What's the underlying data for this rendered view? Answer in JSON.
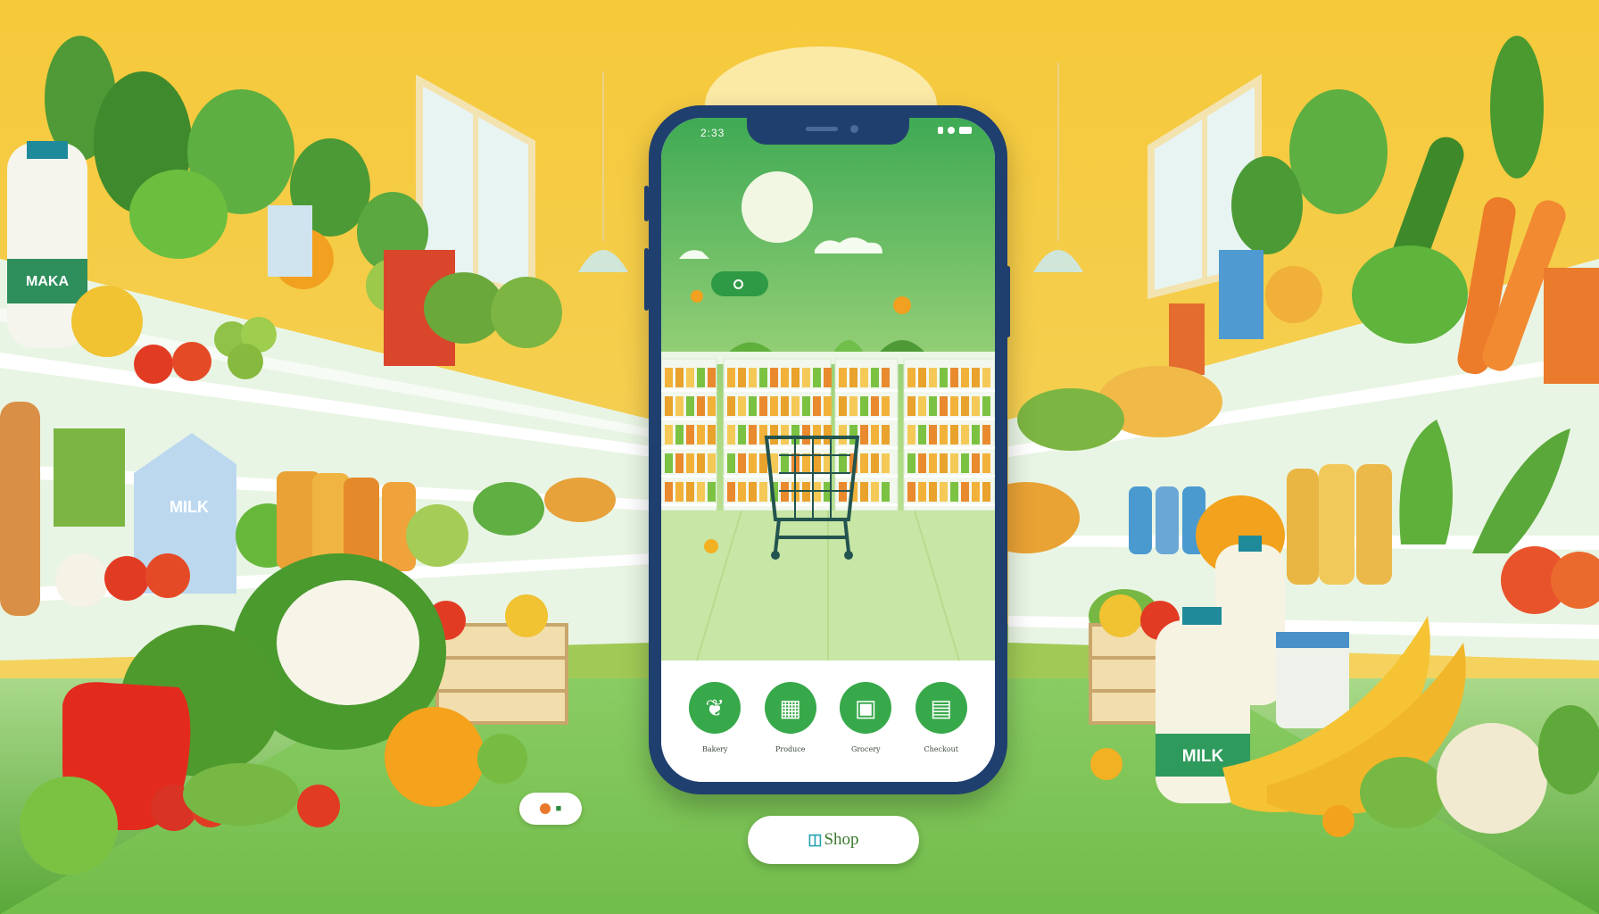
{
  "phone": {
    "status_time": "2:33",
    "app_chip_label": "",
    "nav_items": [
      {
        "label": "Bakery",
        "icon": "bread-icon"
      },
      {
        "label": "Produce",
        "icon": "basket-icon"
      },
      {
        "label": "Grocery",
        "icon": "shelf-icon"
      },
      {
        "label": "Checkout",
        "icon": "cart-icon"
      }
    ]
  },
  "scene": {
    "milk_labels": [
      "MILK",
      "MILK",
      "MAKA"
    ],
    "colors": {
      "background": "#f4c430",
      "floor": "#6fbf4a",
      "phone_frame": "#1f3f6e",
      "accent_green": "#37a94a"
    }
  },
  "shop_button": {
    "label": "Shop",
    "icon": "bag-icon"
  }
}
